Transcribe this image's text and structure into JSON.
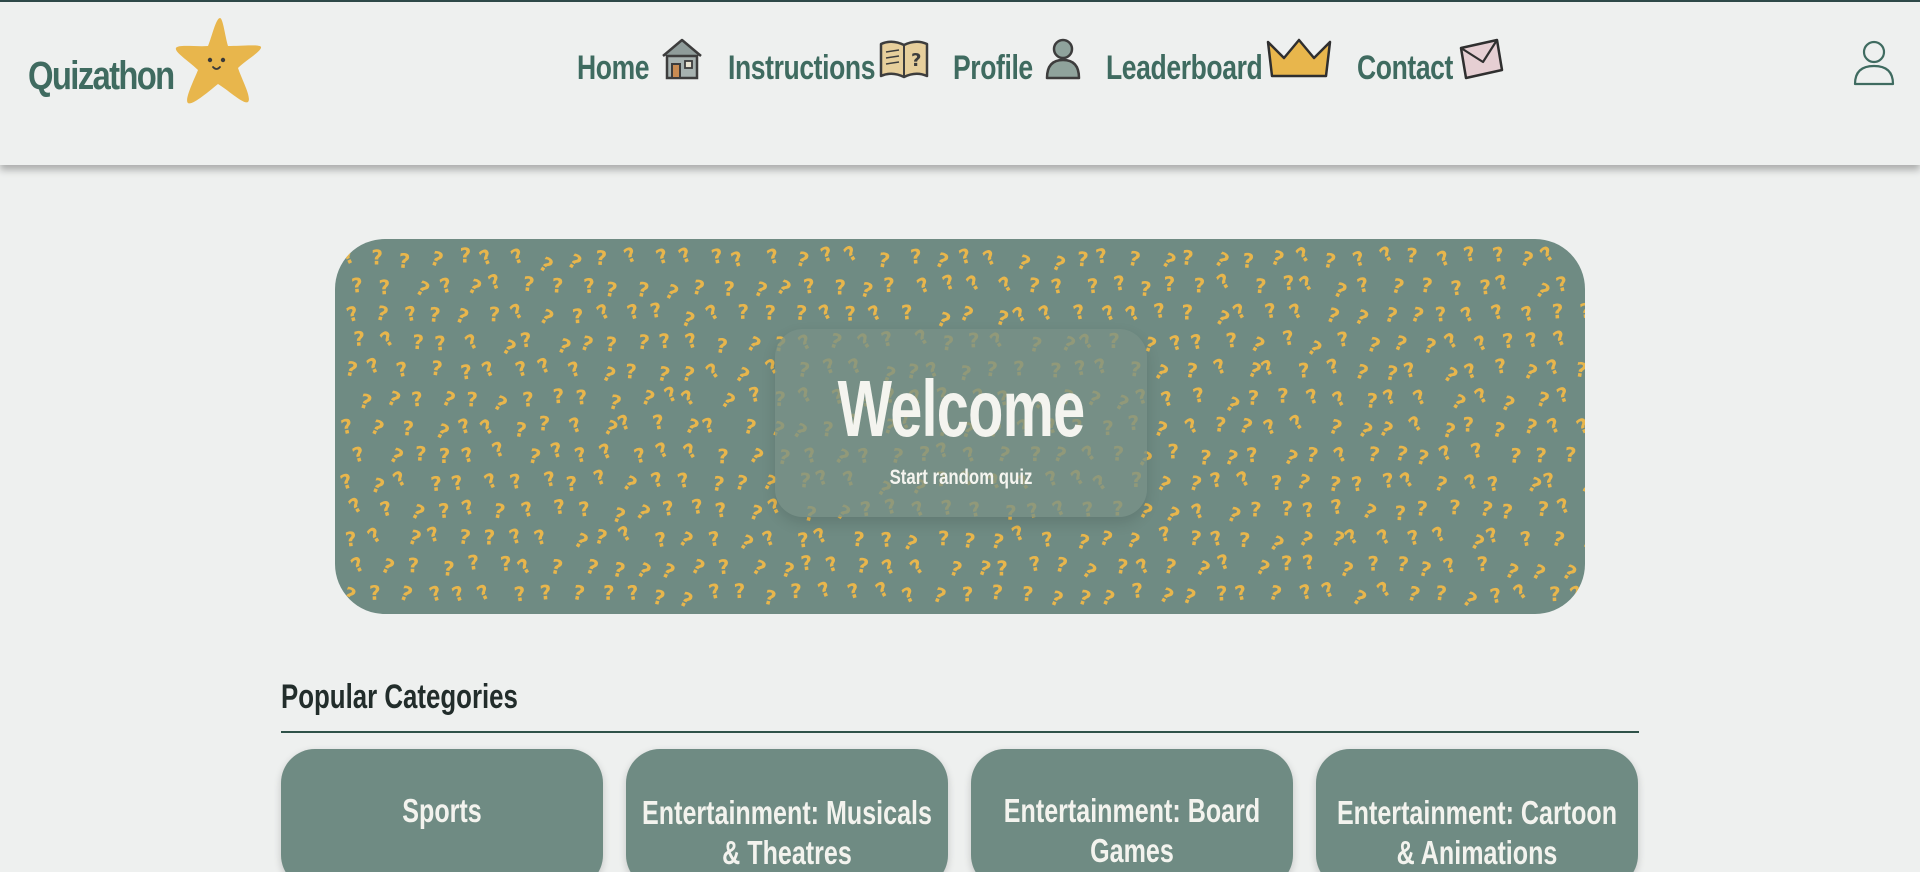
{
  "brand": {
    "name": "Quizathon"
  },
  "nav": [
    {
      "label": "Home",
      "icon": "house-icon"
    },
    {
      "label": "Instructions",
      "icon": "book-question-icon"
    },
    {
      "label": "Profile",
      "icon": "person-icon"
    },
    {
      "label": "Leaderboard",
      "icon": "crown-icon"
    },
    {
      "label": "Contact",
      "icon": "envelope-icon"
    }
  ],
  "user_icon": "user-account-icon",
  "hero": {
    "title": "Welcome",
    "subtitle": "Start random quiz",
    "pattern_icon": "question-mark-pattern"
  },
  "popular": {
    "title": "Popular Categories",
    "categories": [
      {
        "label": "Sports"
      },
      {
        "label": "Entertainment: Musicals & Theatres"
      },
      {
        "label": "Entertainment: Board Games"
      },
      {
        "label": "Entertainment: Cartoon & Animations"
      }
    ]
  },
  "colors": {
    "background": "#eef0ef",
    "primary_green": "#3f6b60",
    "card_green": "#6f8b83",
    "accent_yellow": "#e8b64c",
    "text_dark": "#222d2b"
  }
}
